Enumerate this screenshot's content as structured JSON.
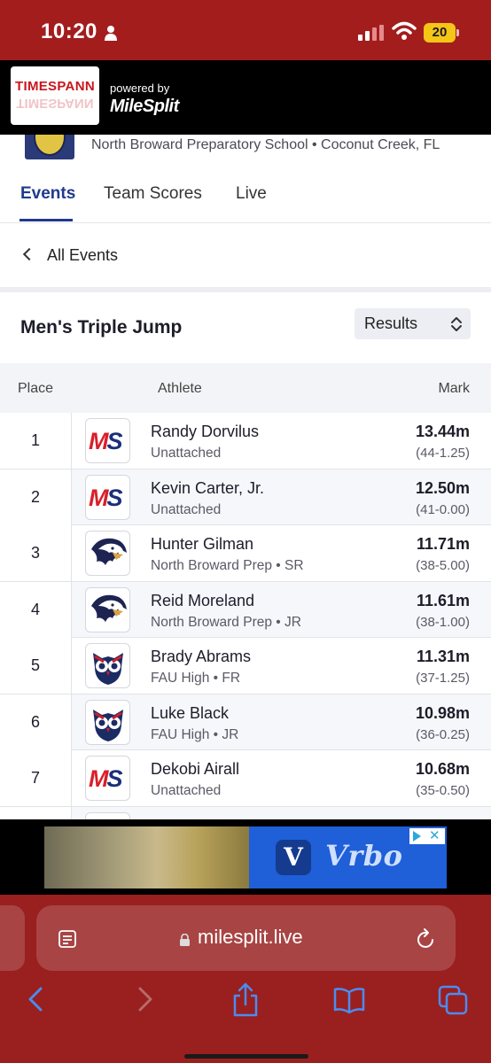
{
  "status_bar": {
    "time": "10:20",
    "battery": "20"
  },
  "brand": {
    "logo_text": "TIMESPANN",
    "powered_by": "powered by",
    "partner": "MileSplit"
  },
  "meet": {
    "location": "North Broward Preparatory School • Coconut Creek, FL"
  },
  "tabs": [
    {
      "label": "Events",
      "active": true
    },
    {
      "label": "Team Scores",
      "active": false
    },
    {
      "label": "Live",
      "active": false
    }
  ],
  "nav": {
    "back_label": "All Events"
  },
  "event": {
    "title": "Men's Triple Jump",
    "view_select": "Results"
  },
  "table": {
    "headers": {
      "place": "Place",
      "athlete": "Athlete",
      "mark": "Mark"
    },
    "rows": [
      {
        "place": "1",
        "name": "Randy Dorvilus",
        "team": "Unattached",
        "mark": "13.44m",
        "imperial": "(44-1.25)",
        "logo": "milesplit"
      },
      {
        "place": "2",
        "name": "Kevin Carter, Jr.",
        "team": "Unattached",
        "mark": "12.50m",
        "imperial": "(41-0.00)",
        "logo": "milesplit"
      },
      {
        "place": "3",
        "name": "Hunter Gilman",
        "team": "North Broward Prep • SR",
        "mark": "11.71m",
        "imperial": "(38-5.00)",
        "logo": "eagle"
      },
      {
        "place": "4",
        "name": "Reid Moreland",
        "team": "North Broward Prep • JR",
        "mark": "11.61m",
        "imperial": "(38-1.00)",
        "logo": "eagle"
      },
      {
        "place": "5",
        "name": "Brady Abrams",
        "team": "FAU High • FR",
        "mark": "11.31m",
        "imperial": "(37-1.25)",
        "logo": "owl"
      },
      {
        "place": "6",
        "name": "Luke Black",
        "team": "FAU High • JR",
        "mark": "10.98m",
        "imperial": "(36-0.25)",
        "logo": "owl"
      },
      {
        "place": "7",
        "name": "Dekobi Airall",
        "team": "Unattached",
        "mark": "10.68m",
        "imperial": "(35-0.50)",
        "logo": "milesplit"
      }
    ]
  },
  "ad": {
    "brand": "Vrbo",
    "icon_letter": "V",
    "choices_x": "✕"
  },
  "browser": {
    "url": "milesplit.live"
  },
  "colors": {
    "status_bar": "#a31d1d",
    "accent": "#1f3a8f",
    "milesplit_red": "#d8202a",
    "milesplit_blue": "#1b2f7a",
    "browser_chrome": "#9a1f1f"
  }
}
